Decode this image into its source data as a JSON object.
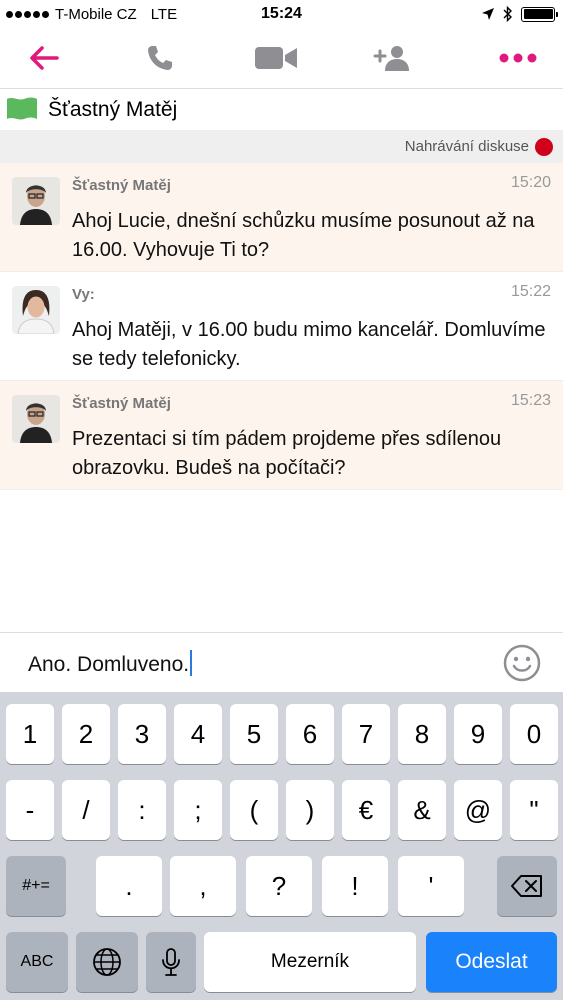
{
  "status_bar": {
    "carrier": "T-Mobile CZ",
    "network": "LTE",
    "time": "15:24"
  },
  "toolbar": {
    "icons": [
      "back-arrow-icon",
      "phone-icon",
      "video-camera-icon",
      "add-person-icon",
      "more-dots-icon"
    ],
    "accent_color": "#e0197d",
    "icon_color": "#8e8e93"
  },
  "contact": {
    "name": "Šťastný Matěj",
    "flag_color": "#5cb85c"
  },
  "recording": {
    "label": "Nahrávání diskuse",
    "dot_color": "#d0021b"
  },
  "messages": [
    {
      "type": "incoming",
      "author": "Šťastný Matěj",
      "time": "15:20",
      "text": "Ahoj Lucie, dnešní schůzku musíme posunout až na 16.00. Vyhovuje Ti to?"
    },
    {
      "type": "outgoing",
      "author": "Vy:",
      "time": "15:22",
      "text": "Ahoj Matěji, v 16.00 budu mimo kancelář. Domluvíme se tedy telefonicky."
    },
    {
      "type": "incoming",
      "author": "Šťastný Matěj",
      "time": "15:23",
      "text": "Prezentaci si tím pádem projdeme přes sdílenou obrazovku. Budeš na počítači?"
    }
  ],
  "composer": {
    "value": "Ano. Domluveno."
  },
  "keyboard": {
    "row1": [
      "1",
      "2",
      "3",
      "4",
      "5",
      "6",
      "7",
      "8",
      "9",
      "0"
    ],
    "row2": [
      "-",
      "/",
      ":",
      ";",
      "(",
      ")",
      "€",
      "&",
      "@",
      "\""
    ],
    "row3_left": "#+=",
    "row3": [
      ".",
      ",",
      "?",
      "!",
      "'"
    ],
    "abc": "ABC",
    "space": "Mezerník",
    "send": "Odeslat"
  }
}
